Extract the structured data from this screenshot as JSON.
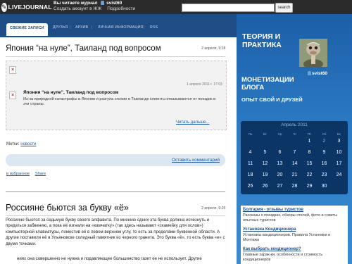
{
  "topbar": {
    "logo_text": "LIVEJOURNAL",
    "reading_label": "Вы читаете журнал",
    "journal_user": "svist60",
    "sub_links": [
      "Создать аккаунт в ЖЖ",
      "Подробности"
    ],
    "search_placeholder": "",
    "search_button": "search"
  },
  "nav": {
    "tabs": [
      "СВЕЖИЕ ЗАПИСИ",
      "ДРУЗЬЯ",
      "АРХИВ",
      "ЛИЧНАЯ ИНФОРМАЦИЯ",
      "RSS"
    ]
  },
  "sidebar": {
    "journal_title": "ТЕОРИЯ И ПРАКТИКА",
    "username": "svist60",
    "subtitle": "МОНЕТИЗАЦИИ БЛОГА",
    "subtitle2": "ОПЫТ СВОЙ И ДРУЗЕЙ",
    "calendar": {
      "month": "Апрель 2011",
      "dow": [
        "Пн",
        "Вт",
        "Ср",
        "Чт",
        "Пт",
        "Сб",
        "Вс"
      ],
      "weeks": [
        [
          "",
          "",
          "",
          "",
          "1",
          "2",
          "3"
        ],
        [
          "4",
          "5",
          "6",
          "7",
          "8",
          "9",
          "10"
        ],
        [
          "11",
          "12",
          "13",
          "14",
          "15",
          "16",
          "17"
        ],
        [
          "18",
          "19",
          "20",
          "21",
          "22",
          "23",
          "24"
        ],
        [
          "25",
          "26",
          "27",
          "28",
          "29",
          "30",
          ""
        ]
      ],
      "linked_days": [
        "2"
      ]
    },
    "ads": [
      {
        "title": "Болгария - отзывы туристов",
        "text": "Рассказы о поездках, обзоры отелей, фото и советы опытных туристов"
      },
      {
        "title": "Установка Кондиционера",
        "text": "Установка кондиционеров. Правила Установки и Монтажа"
      },
      {
        "title": "Как выбрать кондиционер?",
        "text": "Главные харак-ки, особенности и стоимость кондиционеров"
      }
    ]
  },
  "posts": [
    {
      "title": "Япония “на нуле”, Таиланд под вопросом",
      "date": "2 апреля, 9:28",
      "embed": {
        "date": "1 апреля 2011 г. 17:03",
        "title": "Япония “на нуле”, Таиланд под вопросом",
        "text": "Из-за природной катастрофы в Японии и разгула стихии в Таиланде клиенты отказываются от поездок в эти страны.",
        "read_more": "Читать дальше..."
      },
      "tags_label": "Метки:",
      "tag": "новости",
      "comment_link": "Оставить комментарий",
      "links": [
        "в избранное",
        "Share"
      ]
    },
    {
      "title": "Россияне бьются за букву «ё»",
      "date": "2 апреля, 9:25",
      "paragraphs": [
        "Россияне бьются за седьмую букву своего алфавита. По мнению одних эта буква должна исчезнуть и предаться забвению, а пока её изгнали на «камчатку» (так здесь называют «скамейку для ослов») компьютерной клавиатуры, поместив её в левом верхнем углу, то есть за пределами буквенной области. А другие поставили её в Ульяновске солидный памятник из черного гранита. Это буква «ё», то есть буква «е» с двумя точками.",
        "ниях она совершенно не нужна и подавляющее большинство газет ее не использует. Другие"
      ]
    }
  ]
}
